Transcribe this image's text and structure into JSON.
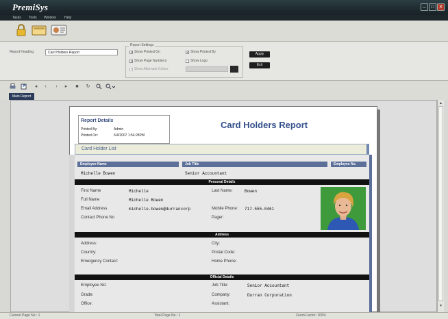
{
  "app": {
    "logo_text": "PremiSys"
  },
  "window_controls": {
    "minimize": "–",
    "maximize": "□",
    "close": "✕"
  },
  "menu": [
    "Tasks",
    "Tools",
    "Window",
    "Help"
  ],
  "toolbar": {
    "icons": [
      "lock-icon",
      "card-icon",
      "badge-icon"
    ]
  },
  "settings": {
    "heading_label": "Report Heading",
    "heading_value": "Card Holders Report",
    "group_title": "Report Settings",
    "show_printed_on": "Show Printed On",
    "show_printed_by": "Show Printed By",
    "show_page_numbers": "Show Page Numbers",
    "show_logo": "Show Logo",
    "show_alternate_colors": "Show Alternate Colors",
    "apply_label": "Apply",
    "exit_label": "Exit"
  },
  "nav": {
    "icons": [
      "print-icon",
      "export-icon",
      "first-page-icon",
      "prev-page-icon",
      "next-page-icon",
      "last-page-icon",
      "stop-icon",
      "refresh-icon",
      "find-icon",
      "zoom-icon"
    ]
  },
  "tab": {
    "label": "Main Report"
  },
  "report": {
    "details_title": "Report Details",
    "printed_by_label": "Printed By:",
    "printed_by_value": "Admin",
    "printed_on_label": "Printed On:",
    "printed_on_value": "6/4/2007  1:54:28PM",
    "title": "Card Holders Report",
    "list_title": "Card Holder List",
    "columns": [
      "Employee Name",
      "Job Title",
      "Employee No."
    ],
    "row": {
      "name": "Michelle  Bowen",
      "job_title": "Senior Accountant"
    },
    "personal_header": "Personal Details",
    "first_name_label": "First Name",
    "first_name_value": "Michelle",
    "last_name_label": "Last Name:",
    "last_name_value": "Bowen",
    "full_name_label": "Full Name",
    "full_name_value": "Michelle  Bowen",
    "email_label": "Email Address",
    "email_value": "michelle.bowen@durrancorp",
    "mobile_label": "Mobile Phone:",
    "mobile_value": "717-555-0461",
    "contact_label": "Contact Phone No",
    "pager_label": "Pager:",
    "address_header": "Address",
    "address_label": "Address:",
    "city_label": "City:",
    "country_label": "Country:",
    "postal_label": "Postal Code:",
    "emergency_label": "Emergency Contact:",
    "home_phone_label": "Home Phone:",
    "official_header": "Official Details",
    "emp_no_label": "Employee No:",
    "job_title_label": "Job Title:",
    "job_title_value": "Senior Accountant",
    "grade_label": "Grade:",
    "company_label": "Company:",
    "company_value": "Durran Corporation",
    "office_label": "Office:",
    "assistant_label": "Assistant:"
  },
  "status": {
    "current_page": "Current Page No.: 1",
    "total_pages": "Total Page No.: 1",
    "zoom": "Zoom Factor: 100%"
  },
  "colors": {
    "title_blue": "#34508a",
    "column_header": "#5b6f98",
    "tab": "#2a3a58"
  }
}
